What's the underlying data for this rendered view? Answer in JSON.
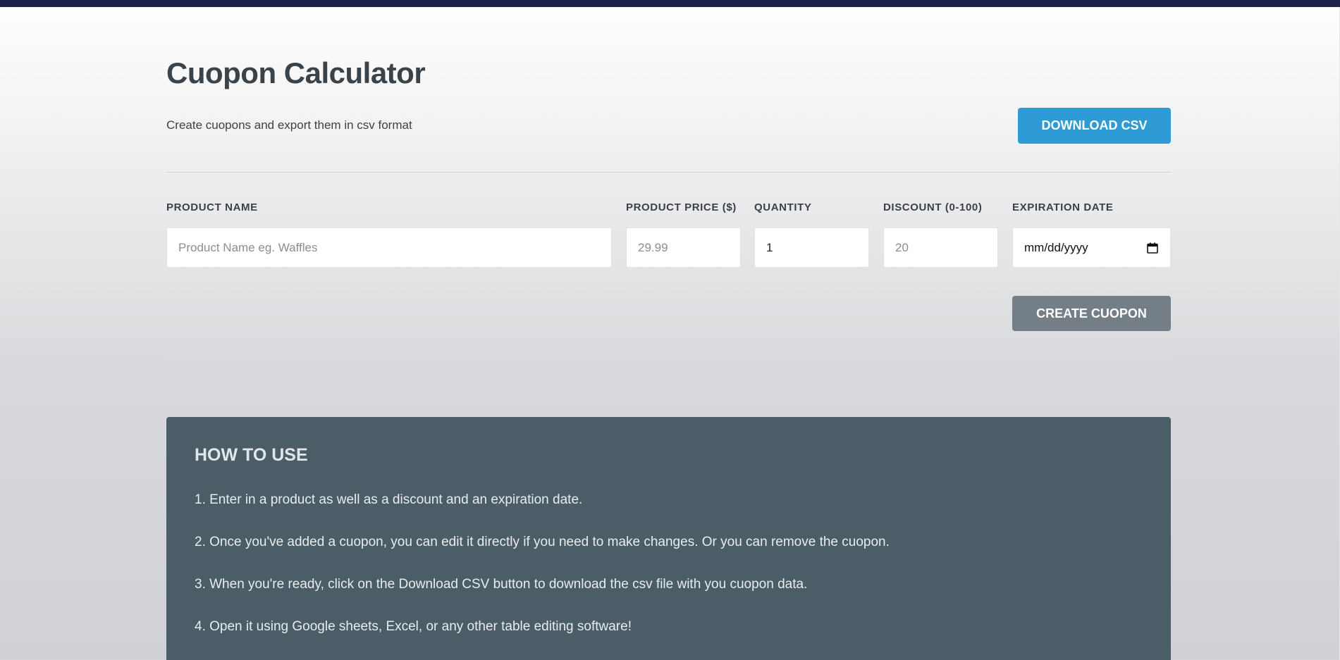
{
  "header": {
    "title": "Cuopon Calculator",
    "subtitle": "Create cuopons and export them in csv format",
    "download_label": "DOWNLOAD CSV"
  },
  "form": {
    "product_name": {
      "label": "PRODUCT NAME",
      "placeholder": "Product Name eg. Waffles",
      "value": ""
    },
    "product_price": {
      "label": "PRODUCT PRICE ($)",
      "placeholder": "29.99",
      "value": ""
    },
    "quantity": {
      "label": "QUANTITY",
      "placeholder": "",
      "value": "1"
    },
    "discount": {
      "label": "DISCOUNT (0-100)",
      "placeholder": "20",
      "value": ""
    },
    "expiration_date": {
      "label": "EXPIRATION DATE",
      "display": "mm/dd/yyyy",
      "icon": "calendar-icon"
    },
    "create_label": "CREATE CUOPON"
  },
  "howto": {
    "title": "HOW TO USE",
    "steps": [
      "1. Enter in a product as well as a discount and an expiration date.",
      "2. Once you've added a cuopon, you can edit it directly if you need to make changes. Or you can remove the cuopon.",
      "3. When you're ready, click on the Download CSV button to download the csv file with you cuopon data.",
      "4. Open it using Google sheets, Excel, or any other table editing software!"
    ]
  },
  "colors": {
    "top_bar": "#1c2249",
    "primary_button": "#2e9bd5",
    "secondary_button": "#737e86",
    "howto_panel": "#4b5d67"
  }
}
